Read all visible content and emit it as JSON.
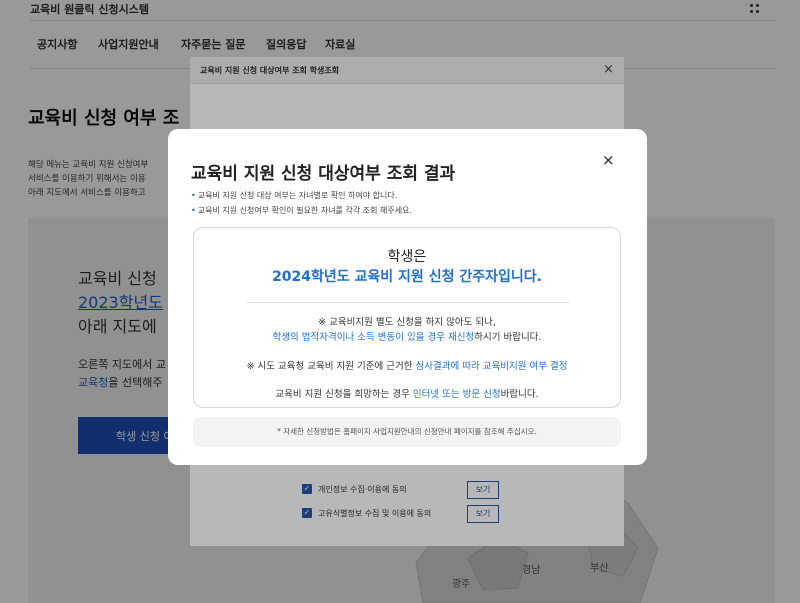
{
  "header": {
    "site_title": "교육비 원클릭 신청시스템"
  },
  "nav": {
    "items": [
      "공지사항",
      "사업지원안내",
      "자주묻는 질문",
      "질의응답",
      "자료실"
    ]
  },
  "page": {
    "title": "교육비 신청 여부 조",
    "desc_lines": [
      "해당 메뉴는 교육비 지원 신청여부",
      "서비스를 이용하기 위해서는 이용",
      "아래 지도에서 서비스를 이용하고"
    ]
  },
  "map_panel": {
    "line1": "교육비 신청",
    "line2": "2023학년도",
    "line3": "아래 지도에",
    "line4": "오른쪽 지도에서 교",
    "line5_link": "교육청",
    "line5_rest": "을 선택해주",
    "apply_button": "학생 신청 여",
    "regions": {
      "gyeongnam": "경남",
      "busan": "부산",
      "gwangju": "광주"
    }
  },
  "modal_lookup": {
    "title": "교육비 지원 신청 대상여부 조회 학생조회",
    "close_icon": "×",
    "agree_items": [
      {
        "label": "개인정보 수집·이용에 동의",
        "button": "보기"
      },
      {
        "label": "고유식별정보 수집 및 이용에 동의",
        "button": "보기"
      }
    ]
  },
  "modal_result": {
    "title": "교육비 지원 신청 대상여부 조회 결과",
    "close_icon": "×",
    "bullets": [
      "교육비 지원 신청 대상 여부는 자녀별로 확인 하여야 합니다.",
      "교육비 지원 신청여부 확인이 필요한 자녀를 각각 조회 해주세요."
    ],
    "result_line1": "학생은",
    "result_line2": "2024학년도 교육비 지원 신청 간주자입니다.",
    "note1_a": "※ 교육비지원 별도 신청을 하지 않아도 되나,",
    "note1_b_blue": "학생의 법적자격이나 소득 변동이 있을 경우 재신청",
    "note1_b_rest": "하시기 바랍니다.",
    "note2_a": "※ 시도 교육청 교육비 지원 기준에 근거한 ",
    "note2_blue": "심사결과에 따라 교육비지원 여부 결정",
    "note3_a": "교육비 지원 신청을 희망하는 경우 ",
    "note3_blue": "인터넷 또는 방문 신청",
    "note3_rest": "바랍니다.",
    "footer": "* 자세한 신청방법은 홈페이지 사업지원안내의 신청안내 페이지를 참조해 주십시오."
  },
  "colors": {
    "accent": "#1f6fd1",
    "button": "#1f4fb8"
  }
}
